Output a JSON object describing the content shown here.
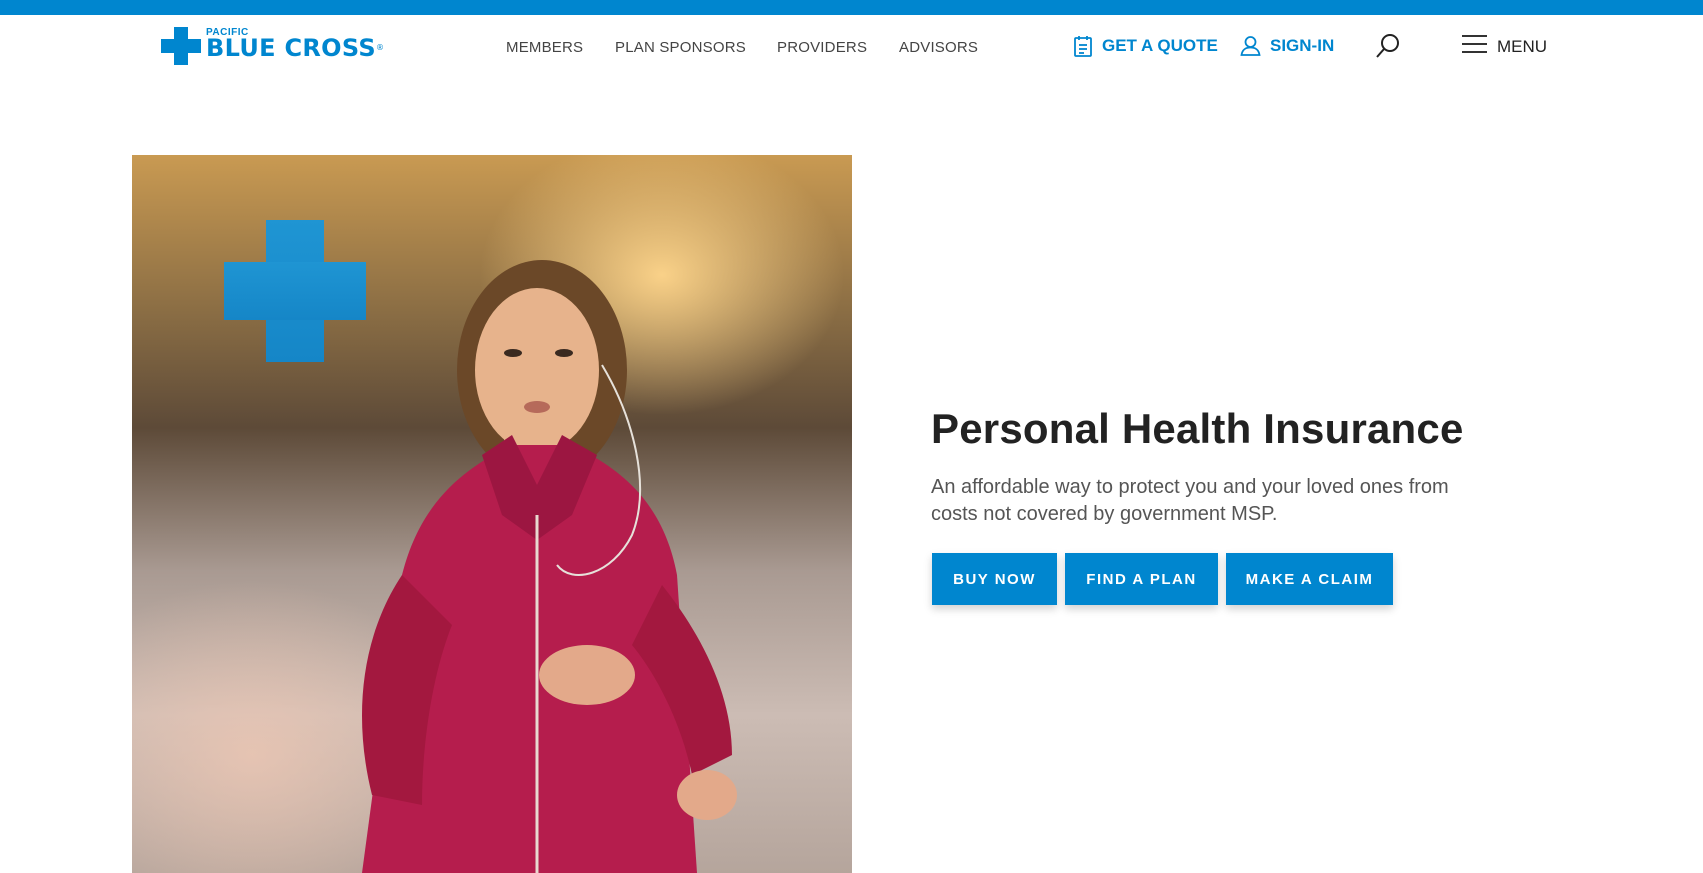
{
  "brand": {
    "small": "PACIFIC",
    "big": "BLUE CROSS",
    "reg": "®"
  },
  "nav": {
    "items": [
      "MEMBERS",
      "PLAN SPONSORS",
      "PROVIDERS",
      "ADVISORS"
    ]
  },
  "utility": {
    "quote_label": "GET A QUOTE",
    "signin_label": "SIGN-IN",
    "menu_label": "MENU"
  },
  "hero": {
    "title": "Personal Health Insurance",
    "subtitle": "An affordable way to protect you and your loved ones from costs not covered by government MSP.",
    "buttons": [
      "BUY NOW",
      "FIND A PLAN",
      "MAKE A CLAIM"
    ]
  },
  "colors": {
    "brand_blue": "#0086cf",
    "title": "#222222",
    "body_text": "#555555"
  },
  "icons": {
    "quote": "clipboard-icon",
    "signin": "user-icon",
    "search": "search-icon",
    "menu": "hamburger-icon"
  }
}
